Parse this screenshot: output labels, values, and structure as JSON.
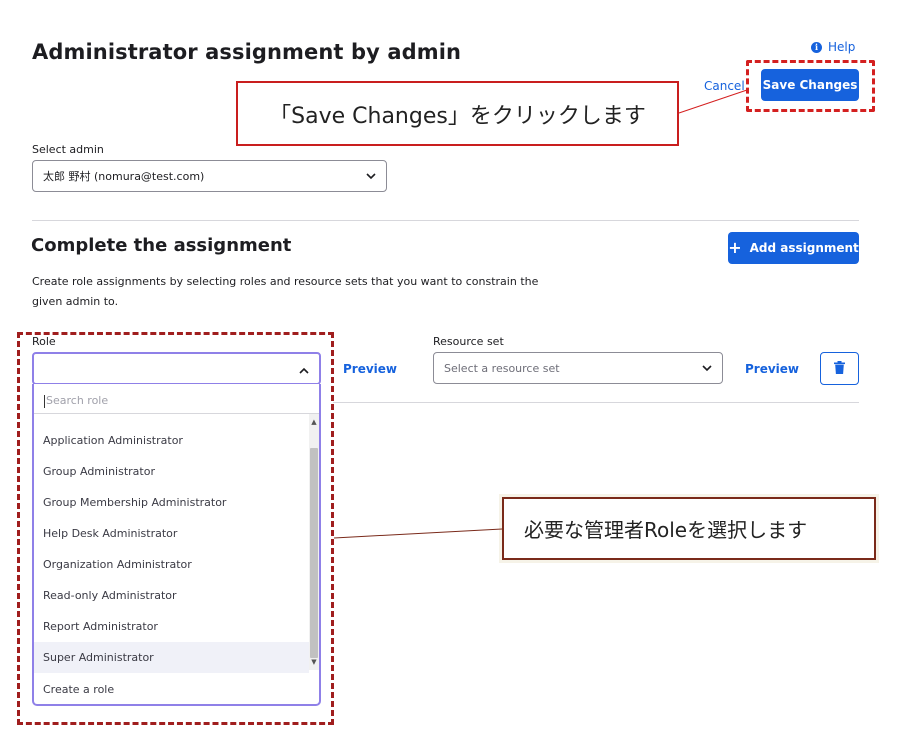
{
  "header": {
    "title": "Administrator assignment by admin",
    "help_label": "Help",
    "info_glyph": "i",
    "cancel_label": "Cancel",
    "save_label": "Save Changes"
  },
  "admin_select": {
    "label": "Select admin",
    "value": "太郎 野村 (nomura@test.com)"
  },
  "assignment": {
    "title": "Complete the assignment",
    "add_label": "Add assignment",
    "description": "Create role assignments by selecting roles and resource sets that you want to constrain the given admin to."
  },
  "role": {
    "label": "Role",
    "value": "",
    "preview_label": "Preview",
    "search_placeholder": "Search role",
    "options": [
      "Application Administrator",
      "Group Administrator",
      "Group Membership Administrator",
      "Help Desk Administrator",
      "Organization Administrator",
      "Read-only Administrator",
      "Report Administrator",
      "Super Administrator"
    ],
    "highlighted_option": "Super Administrator",
    "create_label": "Create a role"
  },
  "resource_set": {
    "label": "Resource set",
    "placeholder": "Select a resource set",
    "preview_label": "Preview"
  },
  "annotations": {
    "save_callout": "「Save Changes」をクリックします",
    "role_callout": "必要な管理者Roleを選択します"
  },
  "colors": {
    "accent": "#1662dd",
    "focus_border": "#8f80e8",
    "callout_red": "#d42020",
    "callout_brown": "#7a2a1a"
  }
}
